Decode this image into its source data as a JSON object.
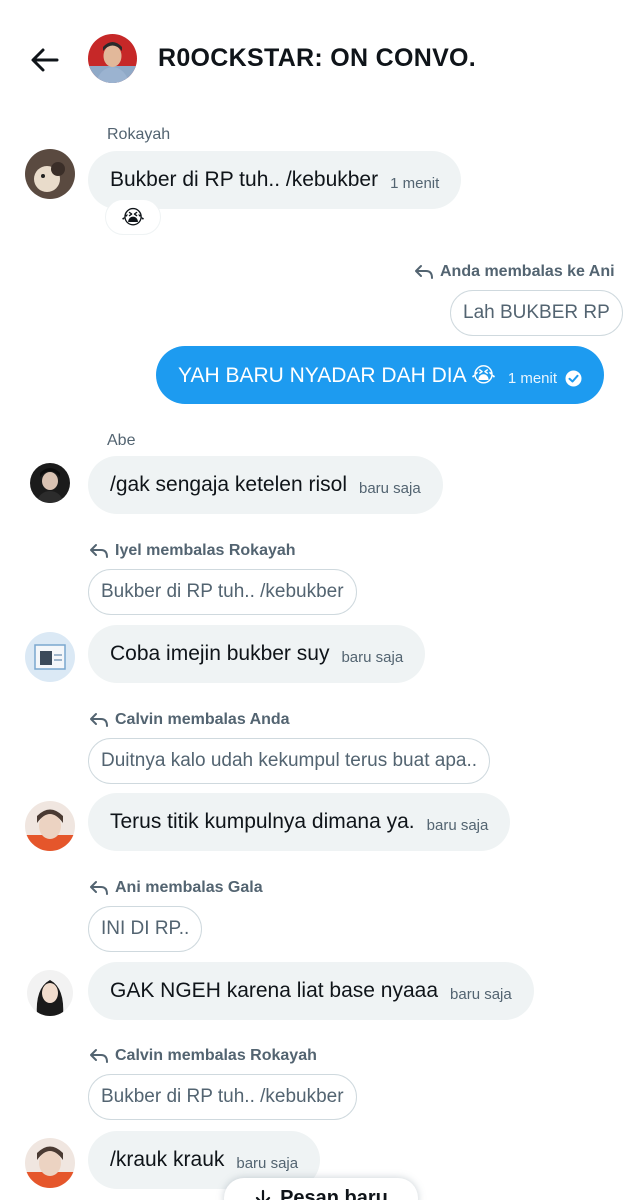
{
  "header": {
    "title": "R0OCKSTAR: ON CONVO.",
    "back_icon": "arrow-left-icon",
    "avatar_desc": "group-avatar"
  },
  "colors": {
    "bubble_other": "#eff3f4",
    "bubble_me": "#1d9bf0",
    "secondary_text": "#536471",
    "primary_text": "#0f1419"
  },
  "messages": [
    {
      "sender": "Rokayah",
      "text": "Bukber di RP tuh.. /kebukber",
      "time": "1 menit",
      "reaction": "😭"
    },
    {
      "reply_line": "Anda membalas ke Ani",
      "quote": "Lah BUKBER RP",
      "text": "YAH BARU NYADAR DAH DIA 😭",
      "time": "1 menit",
      "outgoing": true
    },
    {
      "sender": "Abe",
      "text": "/gak sengaja ketelen risol",
      "time": "baru saja"
    },
    {
      "reply_line": "Iyel membalas Rokayah",
      "quote": "Bukber di RP tuh.. /kebukber",
      "text": "Coba imejin bukber suy",
      "time": "baru saja"
    },
    {
      "reply_line": "Calvin membalas Anda",
      "quote": "Duitnya kalo udah kekumpul terus buat apa..",
      "text": "Terus titik kumpulnya dimana ya.",
      "time": "baru saja"
    },
    {
      "reply_line": "Ani membalas Gala",
      "quote": "INI DI RP..",
      "text": "GAK NGEH karena liat base nyaaa",
      "time": "baru saja"
    },
    {
      "reply_line": "Calvin membalas Rokayah",
      "quote": "Bukber di RP tuh.. /kebukber",
      "text": "/krauk krauk",
      "time": "baru saja"
    }
  ],
  "new_messages_pill": {
    "label": "Pesan baru",
    "icon": "arrow-down-icon"
  }
}
